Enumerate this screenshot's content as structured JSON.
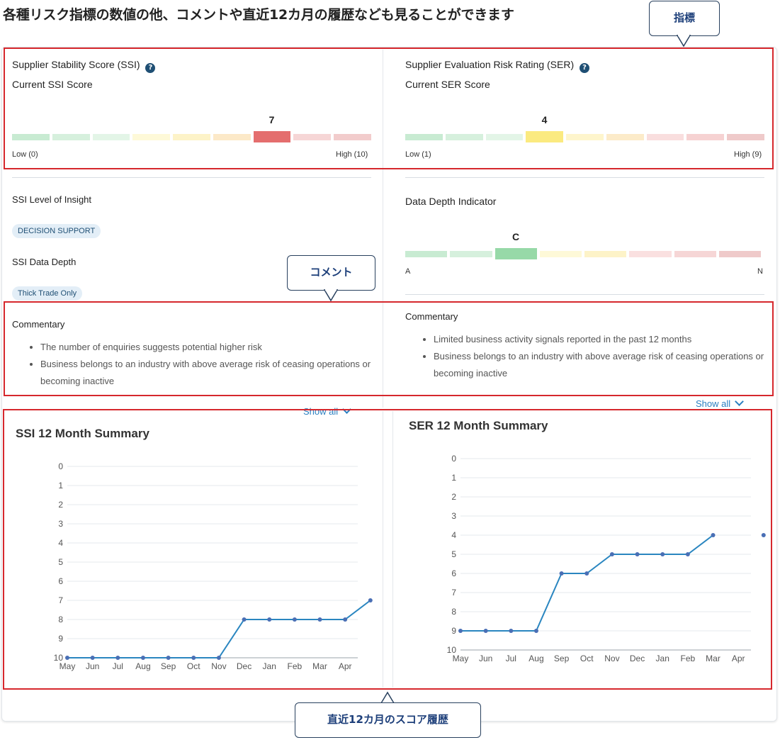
{
  "headline": "各種リスク指標の数値の他、コメントや直近12カ月の履歴なども見ることができます",
  "callouts": {
    "indicator": "指標",
    "comment": "コメント",
    "history": "直近12カ月のスコア履歴"
  },
  "ssi": {
    "title": "Supplier Stability Score (SSI)",
    "help_icon": "question-circle-icon",
    "current_label": "Current SSI Score",
    "score": "7",
    "score_index": 6,
    "low_label": "Low (0)",
    "high_label": "High (10)",
    "segments": [
      "#c8ebd2",
      "#d6f0dd",
      "#e3f5e7",
      "#fef9d8",
      "#fdf3c8",
      "#fce9c8",
      "#e46e6e",
      "#f6d6d6",
      "#f2cccc"
    ],
    "level_title": "SSI Level of Insight",
    "level_value": "DECISION SUPPORT",
    "depth_title": "SSI Data Depth",
    "depth_value": "Thick Trade Only",
    "commentary_title": "Commentary",
    "commentary": [
      "The number of enquiries suggests potential higher risk",
      "Business belongs to an industry with above average risk of ceasing operations or becoming inactive"
    ],
    "show_all": "Show all"
  },
  "ser": {
    "title": "Supplier Evaluation Risk Rating (SER)",
    "help_icon": "question-circle-icon",
    "current_label": "Current SER Score",
    "score": "4",
    "score_index": 3,
    "low_label": "Low (1)",
    "high_label": "High (9)",
    "segments": [
      "#c8ebd2",
      "#d6f0dd",
      "#e3f5e7",
      "#fbea80",
      "#fef5cc",
      "#fcebc9",
      "#f9dede",
      "#f6d2d2",
      "#efcaca"
    ],
    "depth_title": "Data Depth Indicator",
    "depth_score": "C",
    "depth_index": 2,
    "depth_low": "A",
    "depth_high": "N",
    "depth_segments": [
      "#c8ebd2",
      "#d6f0dd",
      "#97d9a8",
      "#fef9d8",
      "#fdf3c8",
      "#fae0e0",
      "#f6d6d6",
      "#efcaca"
    ],
    "commentary_title": "Commentary",
    "commentary": [
      "Limited business activity signals reported in the past 12 months",
      "Business belongs to an industry with above average risk of ceasing operations or becoming inactive"
    ],
    "show_all": "Show all"
  },
  "chart_data": [
    {
      "type": "line",
      "title": "SSI 12 Month Summary",
      "categories": [
        "May",
        "Jun",
        "Jul",
        "Aug",
        "Sep",
        "Oct",
        "Nov",
        "Dec",
        "Jan",
        "Feb",
        "Mar",
        "Apr"
      ],
      "values": [
        10,
        10,
        10,
        10,
        10,
        10,
        10,
        8,
        8,
        8,
        8,
        8,
        7
      ],
      "y_ticks": [
        0,
        1,
        2,
        3,
        4,
        5,
        6,
        7,
        8,
        9,
        10
      ],
      "ylim": [
        0,
        10
      ],
      "y_inverted": true,
      "grid": true,
      "color": "#2a86c0"
    },
    {
      "type": "line",
      "title": "SER 12 Month Summary",
      "categories": [
        "May",
        "Jun",
        "Jul",
        "Aug",
        "Sep",
        "Oct",
        "Nov",
        "Dec",
        "Jan",
        "Feb",
        "Mar",
        "Apr"
      ],
      "values": [
        9,
        9,
        9,
        9,
        6,
        6,
        5,
        5,
        5,
        5,
        4,
        null,
        4
      ],
      "y_ticks": [
        0,
        1,
        2,
        3,
        4,
        5,
        6,
        7,
        8,
        9,
        10
      ],
      "ylim": [
        0,
        10
      ],
      "y_inverted": true,
      "grid": true,
      "color": "#2a86c0"
    }
  ]
}
